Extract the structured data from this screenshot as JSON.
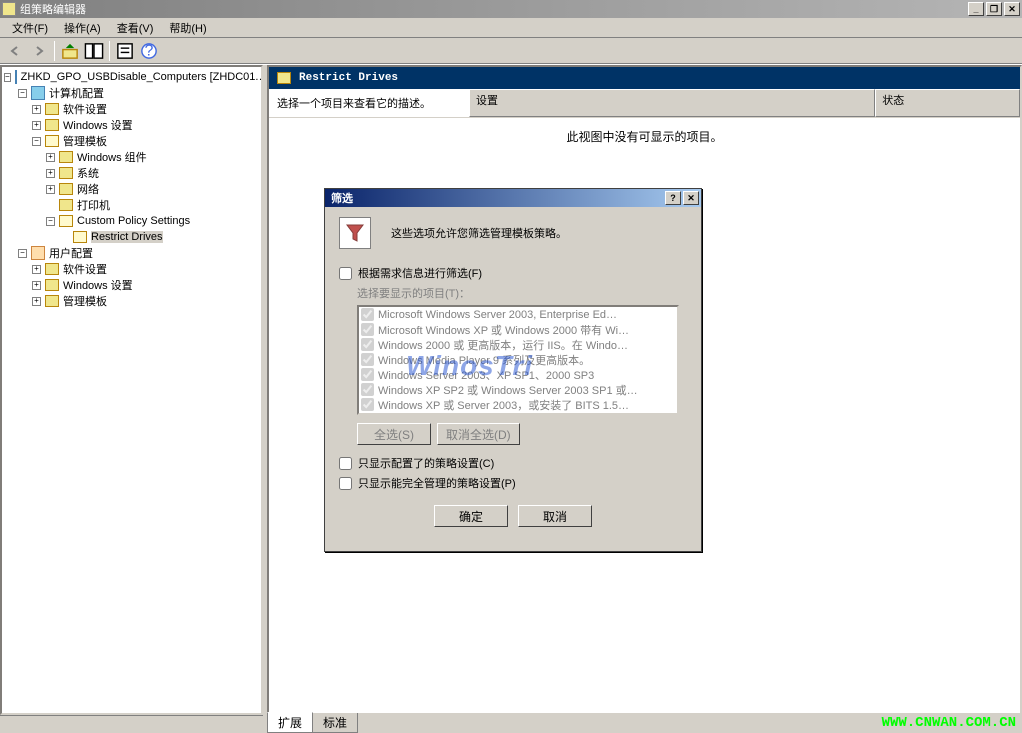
{
  "window": {
    "title": "组策略编辑器"
  },
  "menu": {
    "file": "文件(F)",
    "action": "操作(A)",
    "view": "查看(V)",
    "help": "帮助(H)"
  },
  "tree": {
    "root": "ZHKD_GPO_USBDisable_Computers [ZHDC01.…",
    "computer_config": "计算机配置",
    "software_settings": "软件设置",
    "windows_settings": "Windows 设置",
    "admin_templates": "管理模板",
    "windows_components": "Windows 组件",
    "system": "系统",
    "network": "网络",
    "printers": "打印机",
    "custom_policy": "Custom Policy Settings",
    "restrict_drives": "Restrict Drives",
    "user_config": "用户配置",
    "software_settings2": "软件设置",
    "windows_settings2": "Windows 设置",
    "admin_templates2": "管理模板"
  },
  "content": {
    "title": "Restrict Drives",
    "desc_prompt": "选择一个项目来查看它的描述。",
    "col_setting": "设置",
    "col_state": "状态",
    "empty": "此视图中没有可显示的项目。"
  },
  "tabs": {
    "extended": "扩展",
    "standard": "标准"
  },
  "dialog": {
    "title": "筛选",
    "intro": "这些选项允许您筛选管理模板策略。",
    "chk_filter": "根据需求信息进行筛选(F)",
    "select_items": "选择要显示的项目(T)：",
    "items": [
      "Microsoft Windows Server 2003, Enterprise Ed…",
      "Microsoft Windows XP 或 Windows 2000 带有 Wi…",
      "Windows 2000 或 更高版本，运行 IIS。在 Windo…",
      "Windows Media Player 9 系列及更高版本。",
      "Windows Server 2003、XP SP1、2000 SP3",
      "Windows XP SP2 或 Windows Server 2003 SP1 或…",
      "Windows XP 或 Server 2003，或安装了 BITS 1.5…"
    ],
    "select_all": "全选(S)",
    "deselect_all": "取消全选(D)",
    "chk_configured": "只显示配置了的策略设置(C)",
    "chk_managed": "只显示能完全管理的策略设置(P)",
    "ok": "确定",
    "cancel": "取消"
  },
  "watermark": "WinosTri",
  "url": "WWW.CNWAN.COM.CN"
}
